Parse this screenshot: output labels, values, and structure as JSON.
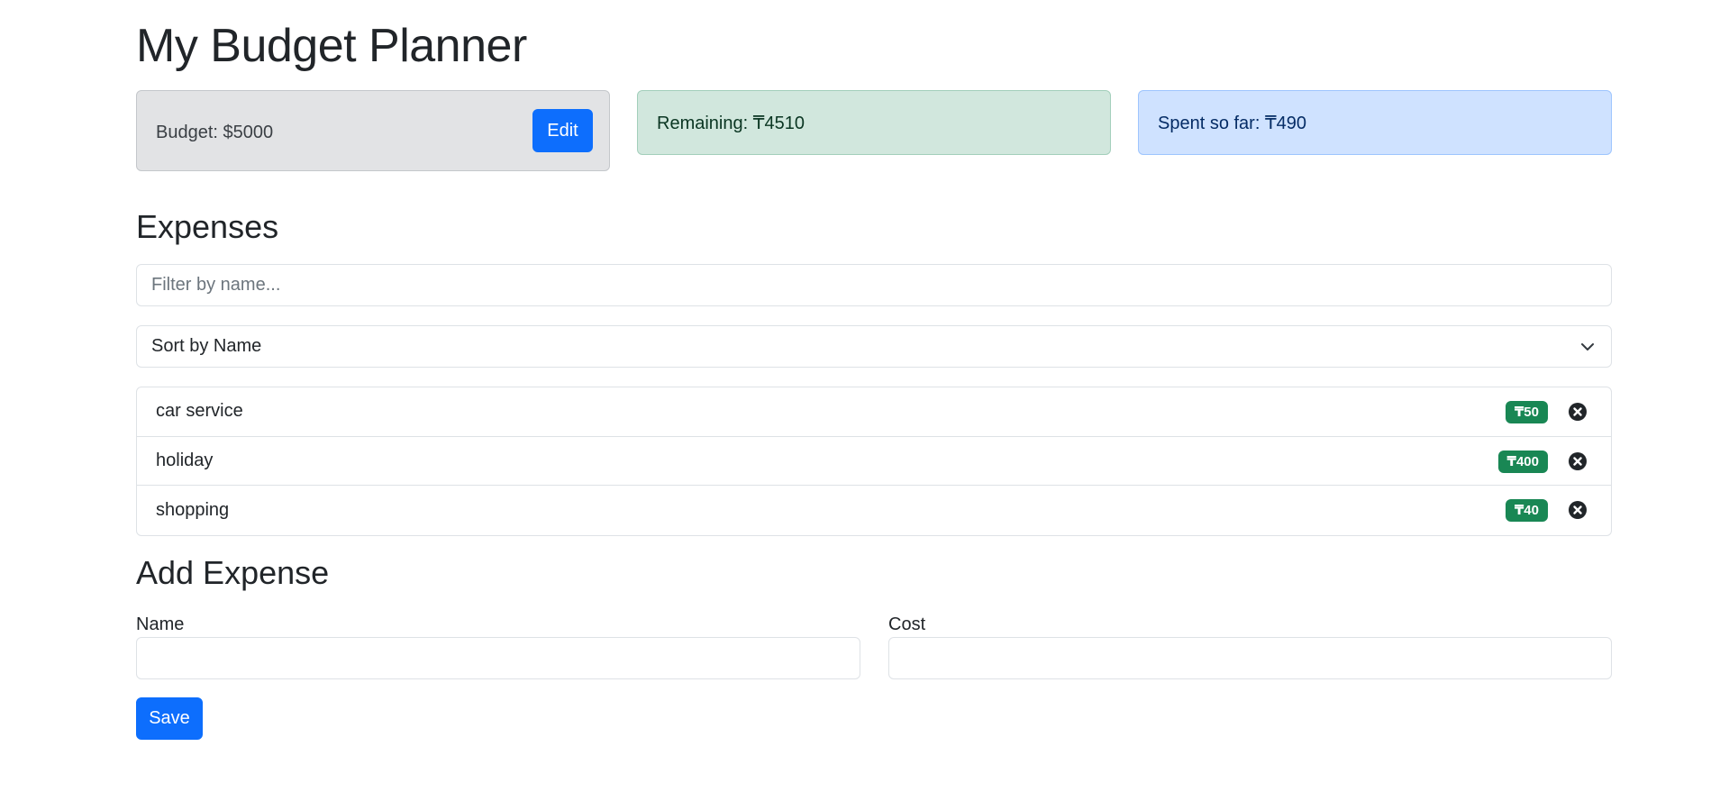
{
  "header": {
    "title": "My Budget Planner"
  },
  "summary": {
    "budget_text": "Budget: $5000",
    "edit_label": "Edit",
    "remaining_text": "Remaining: ₸4510",
    "spent_text": "Spent so far: ₸490"
  },
  "expenses": {
    "title": "Expenses",
    "filter_placeholder": "Filter by name...",
    "sort_selected": "Sort by Name",
    "items": [
      {
        "name": "car service",
        "cost": "₸50"
      },
      {
        "name": "holiday",
        "cost": "₸400"
      },
      {
        "name": "shopping",
        "cost": "₸40"
      }
    ]
  },
  "add_expense": {
    "title": "Add Expense",
    "name_label": "Name",
    "cost_label": "Cost",
    "save_label": "Save"
  },
  "colors": {
    "primary": "#0d6efd",
    "badge_success": "#198754",
    "remaining_bg": "#d1e7dd",
    "spent_bg": "#cfe2ff",
    "budget_bg": "#e2e3e5"
  },
  "icons": {
    "sort_chevron": "chevron-down-icon",
    "delete": "close-circle-icon"
  }
}
